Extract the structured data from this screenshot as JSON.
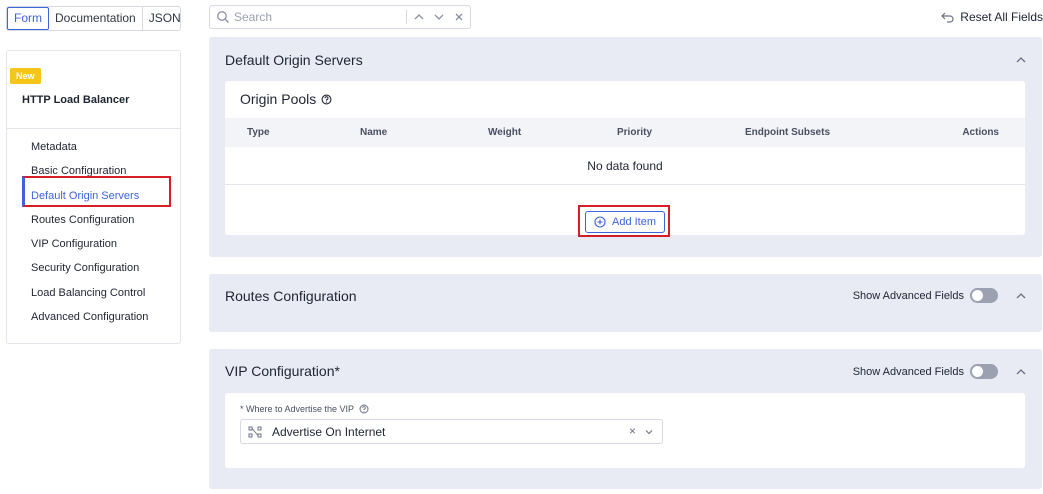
{
  "tabs": [
    "Form",
    "Documentation",
    "JSON"
  ],
  "search": {
    "placeholder": "Search"
  },
  "reset_label": "Reset All Fields",
  "sidebar": {
    "badge": "New",
    "title": "HTTP Load Balancer",
    "items": [
      "Metadata",
      "Basic Configuration",
      "Default Origin Servers",
      "Routes Configuration",
      "VIP Configuration",
      "Security Configuration",
      "Load Balancing Control",
      "Advanced Configuration"
    ],
    "active_index": 2
  },
  "default_origin": {
    "title": "Default Origin Servers",
    "pools_title": "Origin Pools",
    "columns": [
      "Type",
      "Name",
      "Weight",
      "Priority",
      "Endpoint Subsets",
      "Actions"
    ],
    "empty_text": "No data found",
    "add_label": "Add Item"
  },
  "routes": {
    "title": "Routes Configuration",
    "advanced_label": "Show Advanced Fields"
  },
  "vip": {
    "title": "VIP Configuration",
    "required_mark": "*",
    "advanced_label": "Show Advanced Fields",
    "field_label": "* Where to Advertise the VIP",
    "field_value": "Advertise On Internet",
    "clear_glyph": "×"
  },
  "colors": {
    "accent": "#3d63dd",
    "highlight": "#d51f26",
    "section_bg": "#e8ebf3",
    "badge": "#f5c518"
  }
}
